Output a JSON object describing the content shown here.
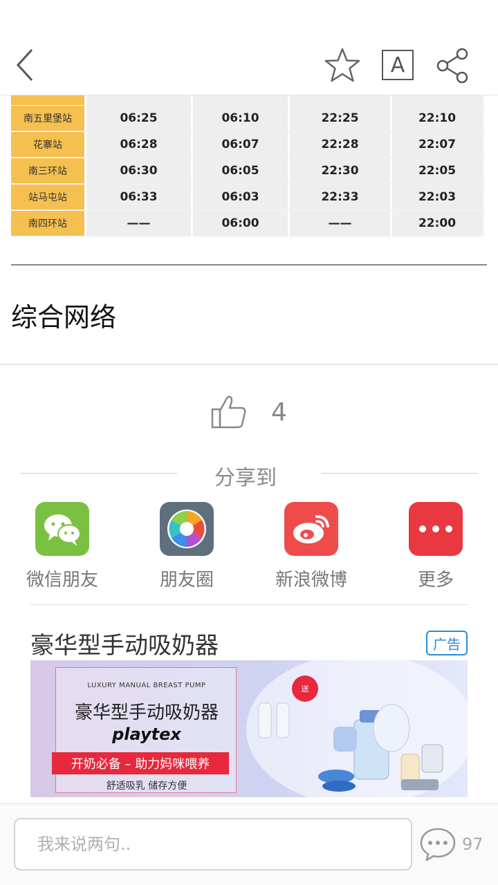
{
  "header": {
    "back_icon": "chevron-left-icon",
    "favorite_icon": "star-outline-icon",
    "font_size_label": "A",
    "share_icon": "share-icon"
  },
  "timetable": {
    "rows": [
      {
        "station": "南五里堡站",
        "times": [
          "06:25",
          "06:10",
          "22:25",
          "22:10"
        ]
      },
      {
        "station": "花寨站",
        "times": [
          "06:28",
          "06:07",
          "22:28",
          "22:07"
        ]
      },
      {
        "station": "南三环站",
        "times": [
          "06:30",
          "06:05",
          "22:30",
          "22:05"
        ]
      },
      {
        "station": "站马屯站",
        "times": [
          "06:33",
          "06:03",
          "22:33",
          "22:03"
        ]
      },
      {
        "station": "南四环站",
        "times": [
          "——",
          "06:00",
          "——",
          "22:00"
        ]
      }
    ]
  },
  "section_title": "综合网络",
  "like": {
    "icon": "thumbs-up-icon",
    "count": "4"
  },
  "share": {
    "label": "分享到",
    "targets": [
      {
        "name": "微信朋友",
        "icon": "wechat-icon",
        "color": "#7ac142"
      },
      {
        "name": "朋友圈",
        "icon": "moments-icon",
        "color": "#5f6f7e"
      },
      {
        "name": "新浪微博",
        "icon": "weibo-icon",
        "color": "#ef4b4b"
      },
      {
        "name": "更多",
        "icon": "more-icon",
        "color": "#e9383f"
      }
    ]
  },
  "ad": {
    "title": "豪华型手动吸奶器",
    "badge": "广告",
    "banner": {
      "english": "LUXURY MANUAL BREAST PUMP",
      "chinese": "豪华型手动吸奶器",
      "brand": "playtex",
      "slogan": "开奶必备 – 助力妈咪喂养",
      "subtitle": "舒适吸乳 储存方便",
      "gift": "送"
    }
  },
  "comment": {
    "placeholder": "我来说两句..",
    "icon": "comment-bubble-icon",
    "count": "97"
  }
}
